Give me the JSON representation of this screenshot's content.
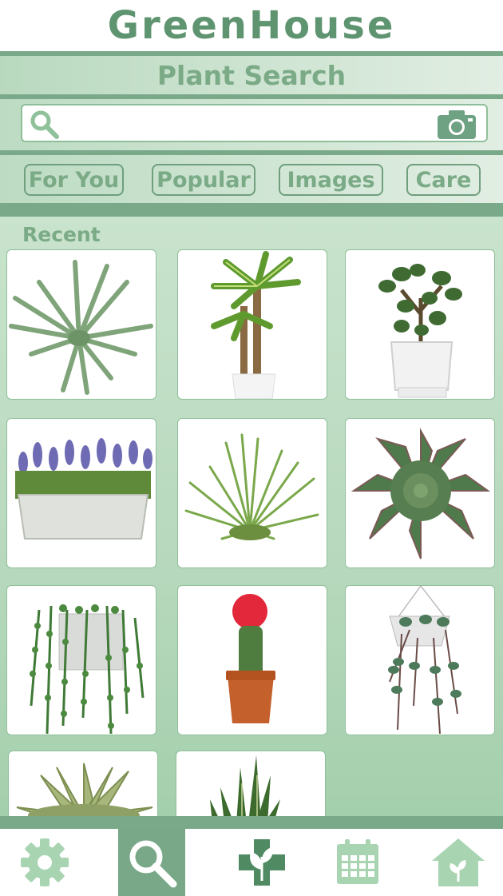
{
  "app": {
    "logo": "GreenHouse"
  },
  "title_bar": {
    "title": "Plant Search"
  },
  "search": {
    "value": "",
    "placeholder": ""
  },
  "tabs": [
    {
      "label": "For You"
    },
    {
      "label": "Popular"
    },
    {
      "label": "Images"
    },
    {
      "label": "Care"
    }
  ],
  "recent": {
    "label": "Recent",
    "items": [
      {
        "icon": "air-plant-image"
      },
      {
        "icon": "dracaena-image"
      },
      {
        "icon": "jade-plant-image"
      },
      {
        "icon": "lavender-planter-image"
      },
      {
        "icon": "tillandsia-image"
      },
      {
        "icon": "echeveria-image"
      },
      {
        "icon": "string-of-pearls-image"
      },
      {
        "icon": "moon-cactus-image"
      },
      {
        "icon": "string-of-hearts-image"
      },
      {
        "icon": "succulent-image"
      },
      {
        "icon": "snake-plant-image"
      }
    ]
  },
  "nav": {
    "active": "search",
    "items": [
      {
        "id": "settings",
        "icon": "gear-icon"
      },
      {
        "id": "search",
        "icon": "search-icon"
      },
      {
        "id": "plant-care",
        "icon": "plant-cross-icon"
      },
      {
        "id": "calendar",
        "icon": "calendar-icon"
      },
      {
        "id": "greenhouse",
        "icon": "house-plant-icon"
      }
    ]
  },
  "colors": {
    "brand": "#5e9470",
    "accent": "#7aa98a",
    "light_green": "#c9e3cd",
    "active_nav": "#78a887"
  }
}
